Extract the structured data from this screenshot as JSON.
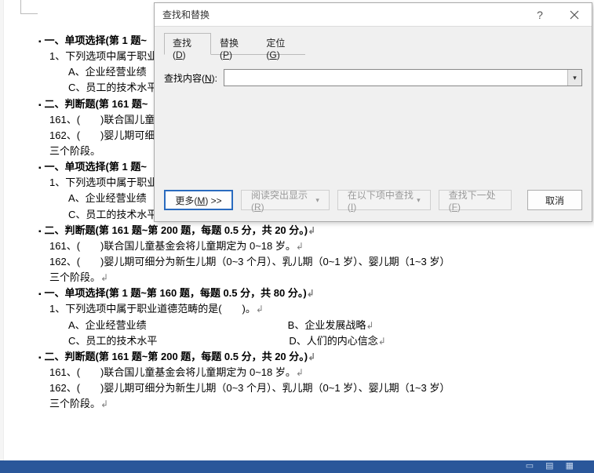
{
  "dialog": {
    "title": "查找和替换",
    "tabs": {
      "find": "查找(D)",
      "replace": "替换(P)",
      "goto": "定位(G)"
    },
    "find_label": "查找内容(N):",
    "find_value": "",
    "buttons": {
      "more": "更多(M) >>",
      "read_highlight": "阅读突出显示(R)",
      "find_in": "在以下项中查找(I)",
      "find_next": "查找下一处(F)",
      "cancel": "取消"
    }
  },
  "doc": {
    "s1_title": "一、单项选择(第 1 题~",
    "s1_q1": "1、下列选项中属于职业",
    "s1_a": "A、企业经营业绩",
    "s1_c": "C、员工的技术水平",
    "s2_title": "二、判断题(第 161 题~",
    "s2_161": "161、(　　)联合国儿童",
    "s2_162": "162、(　　)婴儿期可细",
    "s2_tail": "三个阶段。",
    "s3_title_full": "二、判断题(第 161 题~第 200 题，每题 0.5 分，共 20 分。)",
    "s3_161": "161、(　　)联合国儿童基金会将儿童期定为 0~18 岁。",
    "s3_162": "162、(　　)婴儿期可细分为新生儿期（0~3 个月）、乳儿期（0~1 岁）、婴儿期（1~3 岁）",
    "s4_title": "一、单项选择(第 1 题~第 160 题，每题 0.5 分，共 80 分。)",
    "s4_q1": "1、下列选项中属于职业道德范畴的是(　　)。",
    "s4_a": "A、企业经营业绩",
    "s4_b": "B、企业发展战略",
    "s4_c": "C、员工的技术水平",
    "s4_d": "D、人们的内心信念",
    "eol": "↲"
  }
}
